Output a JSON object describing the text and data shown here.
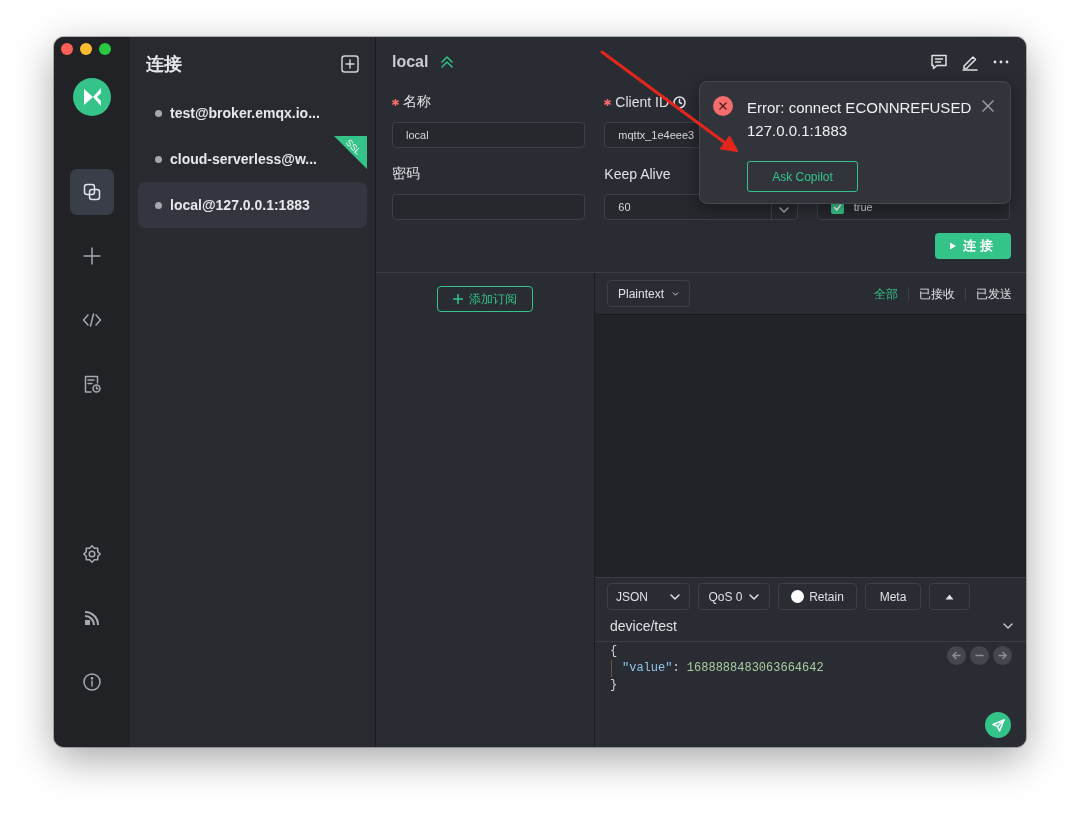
{
  "nav": {
    "top": [
      {
        "kind": "connections",
        "selected": true
      },
      {
        "kind": "new",
        "selected": false
      },
      {
        "kind": "script",
        "selected": false
      },
      {
        "kind": "log",
        "selected": false
      }
    ],
    "bottom": [
      {
        "kind": "settings",
        "selected": false
      },
      {
        "kind": "feed",
        "selected": false
      },
      {
        "kind": "about",
        "selected": false
      }
    ]
  },
  "connections": {
    "title": "连接",
    "items": [
      {
        "name": "test@broker.emqx.io...",
        "selected": false
      },
      {
        "name": "cloud-serverless@w...",
        "selected": false,
        "badge": "SSL"
      },
      {
        "name": "local@127.0.0.1:1883",
        "selected": true
      }
    ]
  },
  "main": {
    "title": "local",
    "form": [
      [
        {
          "label": "名称",
          "required": true,
          "kind": "text",
          "value": "local"
        },
        {
          "label": "Client ID",
          "required": true,
          "kind": "client-id",
          "value": "mqttx_1e4eee3"
        }
      ],
      [
        {
          "label": "密码",
          "required": false,
          "kind": "text"
        },
        {
          "label": "Keep Alive",
          "required": false,
          "kind": "number",
          "value": "60"
        },
        {
          "kind": "checkbox",
          "checked": true,
          "value": "true"
        }
      ]
    ],
    "connect_button": "连接"
  },
  "notification": {
    "kind": "error",
    "message": "Error: connect ECONNREFUSED 127.0.0.1:1883",
    "action": "Ask Copilot"
  },
  "subscriptions": {
    "add_button": "添加订阅"
  },
  "messages": {
    "format": "Plaintext",
    "filters": [
      {
        "label": "全部",
        "selected": true
      },
      {
        "label": "已接收",
        "selected": false
      },
      {
        "label": "已发送",
        "selected": false
      }
    ]
  },
  "publish": {
    "format": "JSON",
    "qos": "QoS 0",
    "retain": {
      "label": "Retain",
      "checked": false
    },
    "meta": "Meta",
    "topic": "device/test",
    "payload": {
      "open": "{",
      "entries": [
        {
          "key": "\"value\"",
          "sep": ":",
          "value": "1688888483063664642"
        }
      ],
      "close": "}"
    }
  }
}
